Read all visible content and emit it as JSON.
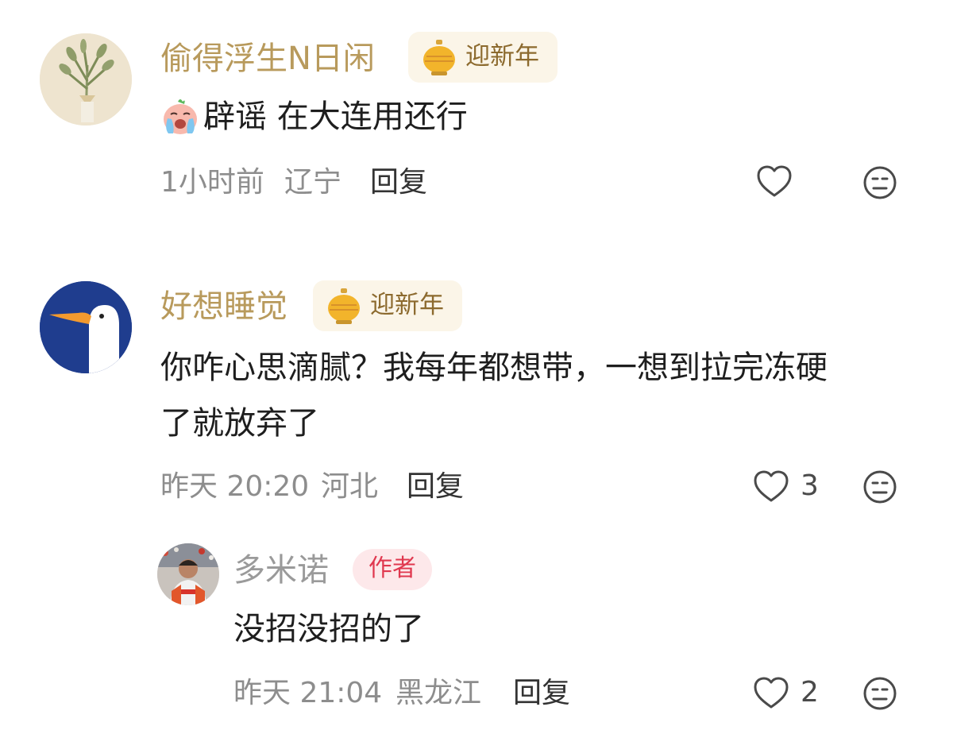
{
  "comments": [
    {
      "user": "偷得浮生N日闲",
      "badge": "迎新年",
      "text": "辟谣 在大连用还行",
      "time": "1小时前",
      "location": "辽宁",
      "reply_label": "回复",
      "likes": ""
    },
    {
      "user": "好想睡觉",
      "badge": "迎新年",
      "text_line1": "你咋心思滴腻？我每年都想带，一想到拉完冻硬",
      "text_line2": "了就放弃了",
      "time": "昨天 20:20",
      "location": "河北",
      "reply_label": "回复",
      "likes": "3"
    }
  ],
  "reply": {
    "user": "多米诺",
    "author_badge": "作者",
    "text": "没招没招的了",
    "time": "昨天 21:04",
    "location": "黑龙江",
    "reply_label": "回复",
    "likes": "2"
  },
  "icons": {
    "badge_icon": "lantern-icon",
    "like": "heart-outline-icon",
    "dislike": "meh-face-icon",
    "emoji": "crying-face-emoji"
  },
  "colors": {
    "username": "#b89a5c",
    "reply_username": "#9a9a9a",
    "author_badge": "#e0384f",
    "meta": "#8d8d8d"
  }
}
